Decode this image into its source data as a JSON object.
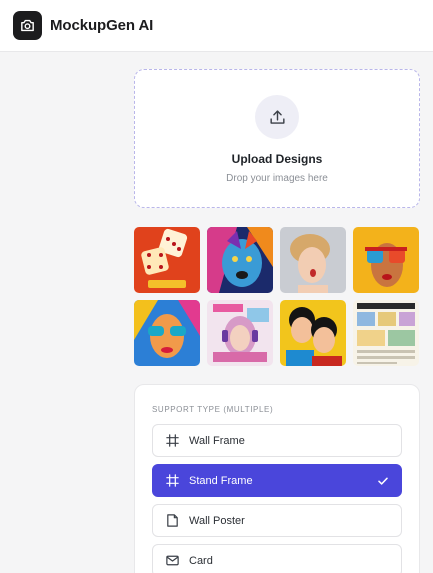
{
  "header": {
    "app_title": "MockupGen AI",
    "logo_icon": "camera-icon"
  },
  "upload": {
    "title": "Upload Designs",
    "subtitle": "Drop your images here",
    "icon": "upload-icon"
  },
  "thumbnails": [
    {
      "name": "dice-image"
    },
    {
      "name": "colorful-dog-image"
    },
    {
      "name": "surprised-woman-image"
    },
    {
      "name": "sunglasses-woman-image"
    },
    {
      "name": "popart-woman-image"
    },
    {
      "name": "headphones-girl-magazine-image"
    },
    {
      "name": "popart-couple-image"
    },
    {
      "name": "comic-newspaper-image"
    }
  ],
  "support": {
    "label": "SUPPORT TYPE (MULTIPLE)",
    "options": [
      {
        "label": "Wall Frame",
        "icon": "frame-icon",
        "selected": false
      },
      {
        "label": "Stand Frame",
        "icon": "frame-icon",
        "selected": true
      },
      {
        "label": "Wall Poster",
        "icon": "poster-icon",
        "selected": false
      },
      {
        "label": "Card",
        "icon": "mail-icon",
        "selected": false
      }
    ]
  },
  "colors": {
    "accent": "#4a46db",
    "dashed_border": "#b9b6ea"
  }
}
